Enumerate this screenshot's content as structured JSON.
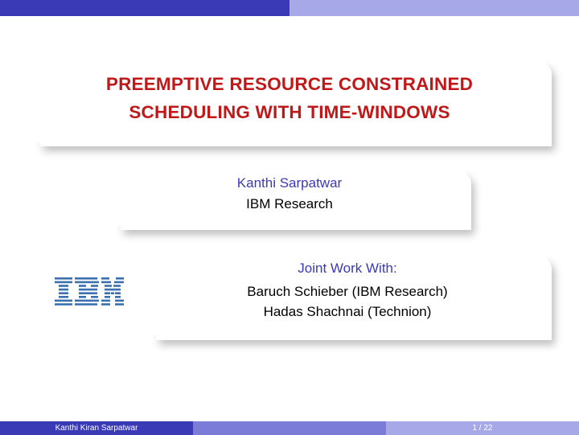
{
  "title": {
    "line1": "PREEMPTIVE RESOURCE CONSTRAINED",
    "line2": "SCHEDULING WITH TIME-WINDOWS"
  },
  "author": {
    "name": "Kanthi Sarpatwar",
    "affiliation": "IBM Research"
  },
  "joint": {
    "heading": "Joint Work With:",
    "coauthor1": "Baruch Schieber (IBM Research)",
    "coauthor2": "Hadas Shachnai (Technion)"
  },
  "footer": {
    "author": "Kanthi Kiran Sarpatwar",
    "page": "1 / 22"
  }
}
